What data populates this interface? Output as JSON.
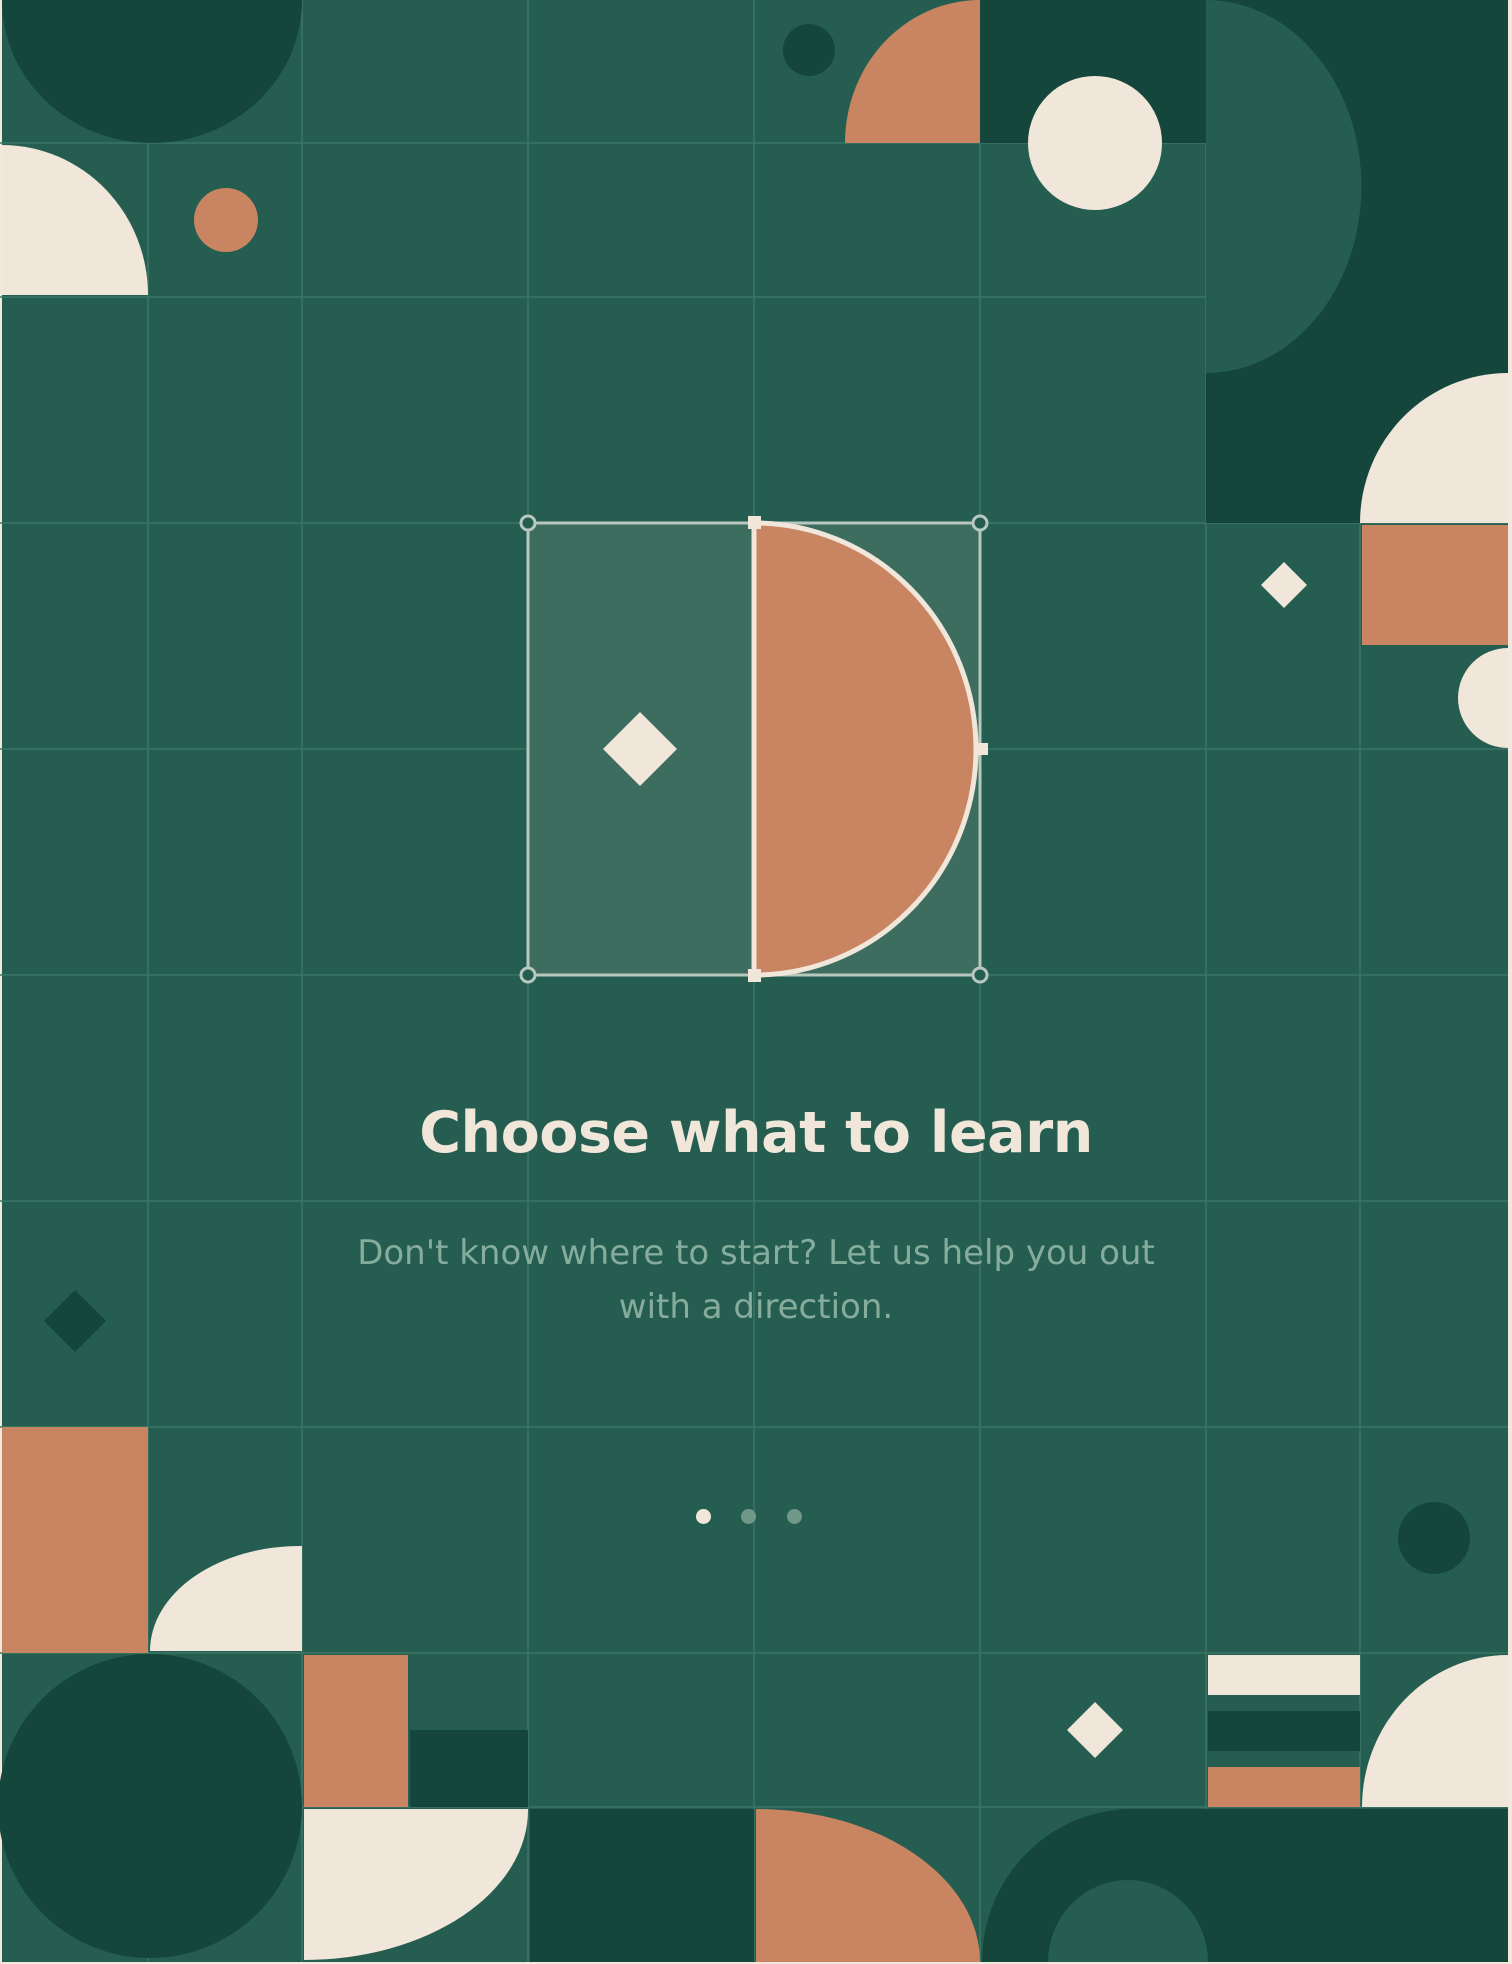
{
  "onboarding": {
    "title": "Choose what to learn",
    "description": "Don't know where to start? Let us help you out with a direction.",
    "pagination": {
      "total_pages": 3,
      "current_page": 1,
      "dots": [
        {
          "active": true
        },
        {
          "active": false
        },
        {
          "active": false
        }
      ]
    }
  },
  "palette": {
    "green": "#255e51",
    "dark_green": "#15463b",
    "terracotta": "#c98462",
    "cream": "#f1e6da",
    "grid_line": "#3a7564",
    "dot_active": "#f1e6da",
    "dot_inactive": "#6f9888"
  },
  "illustration": {
    "shapes": [
      "semicircle",
      "diamond",
      "circle",
      "quarter-circle",
      "rectangle",
      "stripe"
    ],
    "focus_shape": "half-circle-selection"
  }
}
